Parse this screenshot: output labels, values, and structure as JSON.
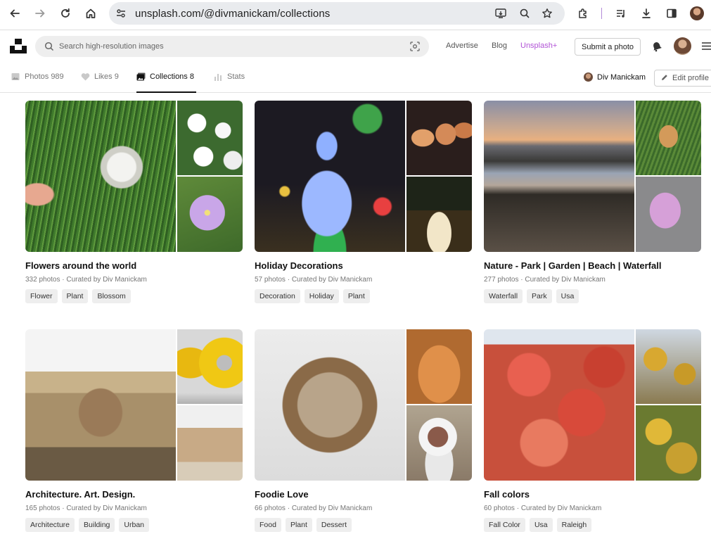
{
  "browser": {
    "url_host": "unsplash.com",
    "url_path": "/@divmanickam/collections"
  },
  "header": {
    "search_placeholder": "Search high-resolution images",
    "nav": [
      "Advertise",
      "Blog",
      "Unsplash+"
    ],
    "submit_label": "Submit a photo"
  },
  "tabs": [
    {
      "label": "Photos",
      "count": "989"
    },
    {
      "label": "Likes",
      "count": "9"
    },
    {
      "label": "Collections",
      "count": "8"
    },
    {
      "label": "Stats",
      "count": ""
    }
  ],
  "profile": {
    "name": "Div Manickam",
    "edit_label": "Edit profile"
  },
  "collections": [
    {
      "title": "Flowers around the world",
      "meta": "332 photos · Curated by Div Manickam",
      "tags": [
        "Flower",
        "Plant",
        "Blossom"
      ]
    },
    {
      "title": "Holiday Decorations",
      "meta": "57 photos · Curated by Div Manickam",
      "tags": [
        "Decoration",
        "Holiday",
        "Plant"
      ]
    },
    {
      "title": "Nature - Park | Garden | Beach | Waterfall",
      "meta": "277 photos · Curated by Div Manickam",
      "tags": [
        "Waterfall",
        "Park",
        "Usa"
      ]
    },
    {
      "title": "Architecture. Art. Design.",
      "meta": "165 photos · Curated by Div Manickam",
      "tags": [
        "Architecture",
        "Building",
        "Urban"
      ]
    },
    {
      "title": "Foodie Love",
      "meta": "66 photos · Curated by Div Manickam",
      "tags": [
        "Food",
        "Plant",
        "Dessert"
      ]
    },
    {
      "title": "Fall colors",
      "meta": "60 photos · Curated by Div Manickam",
      "tags": [
        "Fall Color",
        "Usa",
        "Raleigh"
      ]
    }
  ],
  "colors": {
    "unsplash_plus": "#b153d6",
    "tag_bg": "#eeeeee",
    "muted_text": "#767676"
  }
}
